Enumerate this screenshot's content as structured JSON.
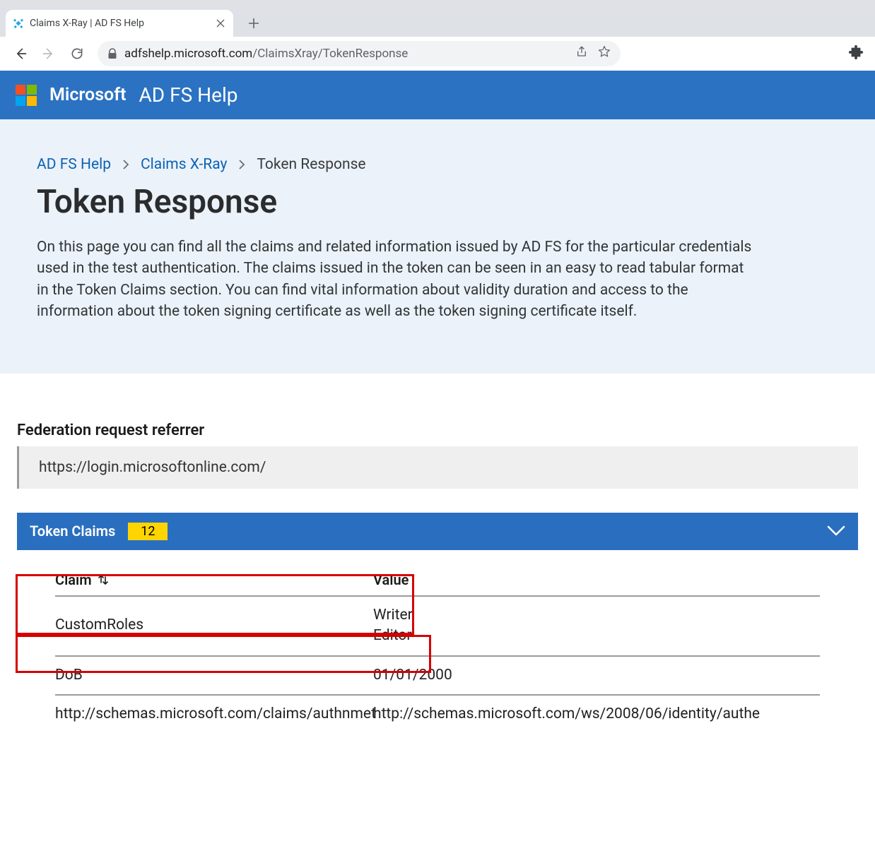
{
  "browser": {
    "tab_title": "Claims X-Ray | AD FS Help",
    "url_host": "adfshelp.microsoft.com",
    "url_path": "/ClaimsXray/TokenResponse"
  },
  "header": {
    "brand": "Microsoft",
    "app": "AD FS Help"
  },
  "breadcrumbs": {
    "root": "AD FS Help",
    "section": "Claims X-Ray",
    "current": "Token Response"
  },
  "hero": {
    "title": "Token Response",
    "description": "On this page you can find all the claims and related information issued by AD FS for the particular credentials used in the test authentication. The claims issued in the token can be seen in an easy to read tabular format in the Token Claims section. You can find vital information about validity duration and access to the information about the token signing certificate as well as the token signing certificate itself."
  },
  "referrer": {
    "label": "Federation request referrer",
    "value": "https://login.microsoftonline.com/"
  },
  "claims_panel": {
    "title": "Token Claims",
    "count": "12"
  },
  "table": {
    "col_claim": "Claim",
    "col_value": "Value",
    "rows": [
      {
        "claim": "CustomRoles",
        "value": "Writer\nEditor"
      },
      {
        "claim": "DoB",
        "value": "01/01/2000"
      },
      {
        "claim": "http://schemas.microsoft.com/claims/authnmet",
        "value": "http://schemas.microsoft.com/ws/2008/06/identity/authe"
      }
    ]
  },
  "colors": {
    "ms_red": "#f25022",
    "ms_green": "#7fba00",
    "ms_blue": "#00a4ef",
    "ms_yellow": "#ffb900"
  }
}
